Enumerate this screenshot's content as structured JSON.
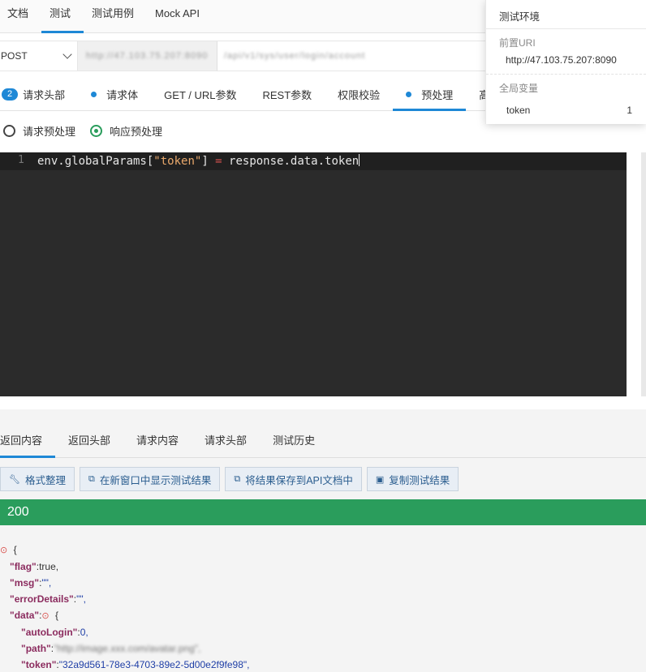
{
  "top_tabs": [
    "文档",
    "测试",
    "测试用例",
    "Mock API"
  ],
  "request": {
    "method": "POST",
    "url_blurred_1": "http://47.103.75.207:8090",
    "url_blurred_2": "/api/v1/sys/user/login/account"
  },
  "sub_tabs": {
    "header_badge": "2",
    "header_label": "请求头部",
    "body_label": "请求体",
    "params_label": "GET / URL参数",
    "rest_label": "REST参数",
    "auth_label": "权限校验",
    "pre_label": "预处理",
    "more_label": "高"
  },
  "radios": {
    "request_pre": "请求预处理",
    "response_pre": "响应预处理"
  },
  "editor": {
    "line_number": "1",
    "code_a": "env.globalParams[",
    "code_str": "\"token\"",
    "code_b": "] ",
    "code_op": "=",
    "code_c": " response.data.token"
  },
  "result_tabs": [
    "返回内容",
    "返回头部",
    "请求内容",
    "请求头部",
    "测试历史"
  ],
  "buttons": {
    "format": "格式整理",
    "new_window": "在新窗口中显示测试结果",
    "save_doc": "将结果保存到API文档中",
    "copy": "复制测试结果"
  },
  "status_code": "200",
  "json": {
    "open": "{",
    "flag_key": "\"flag\"",
    "flag_val": "true,",
    "msg_key": "\"msg\"",
    "msg_val": "\"\",",
    "err_key": "\"errorDetails\"",
    "err_val": "\"\",",
    "data_key": "\"data\"",
    "data_open": "{",
    "auto_key": "\"autoLogin\"",
    "auto_val": "0,",
    "path_key": "\"path\"",
    "path_val": "\"http://image.xxx.com/avatar.png\",",
    "token_key": "\"token\"",
    "token_val": "\"32a9d561-78e3-4703-89e2-5d00e2f9fe98\","
  },
  "env_popup": {
    "title": "测试环境",
    "uri_label": "前置URI",
    "uri_value": "http://47.103.75.207:8090",
    "vars_label": "全局变量",
    "var_name": "token",
    "var_value": "1"
  },
  "colors": {
    "accent": "#1e88d6",
    "success": "#2a9d5c",
    "editor_bg": "#2b2b2b"
  }
}
